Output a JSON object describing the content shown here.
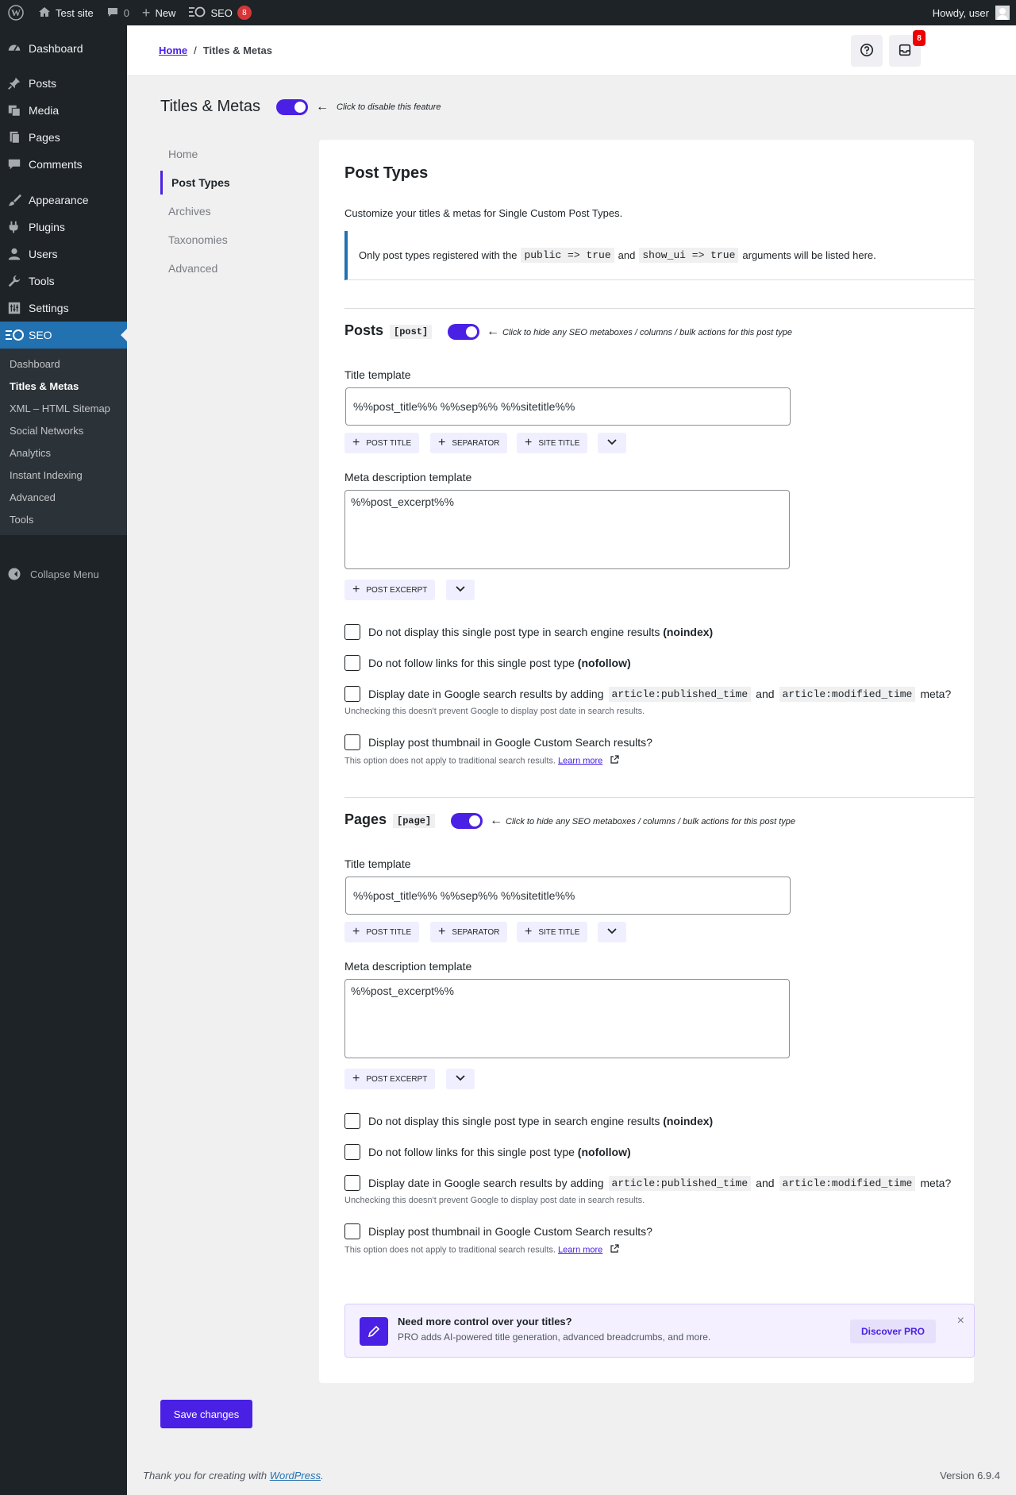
{
  "adminbar": {
    "site_name": "Test site",
    "comments_count": "0",
    "new_label": "New",
    "seo_label": "SEO",
    "seo_badge": "8",
    "greeting": "Howdy, user"
  },
  "menu": {
    "items": [
      {
        "label": "Dashboard",
        "icon": "dashboard-icon"
      },
      {
        "label": "Posts",
        "icon": "pin-icon"
      },
      {
        "label": "Media",
        "icon": "media-icon"
      },
      {
        "label": "Pages",
        "icon": "pages-icon"
      },
      {
        "label": "Comments",
        "icon": "comment-icon"
      },
      {
        "label": "Appearance",
        "icon": "brush-icon"
      },
      {
        "label": "Plugins",
        "icon": "plug-icon"
      },
      {
        "label": "Users",
        "icon": "user-icon"
      },
      {
        "label": "Tools",
        "icon": "wrench-icon"
      },
      {
        "label": "Settings",
        "icon": "settings-icon"
      },
      {
        "label": "SEO",
        "icon": "seo-icon"
      }
    ],
    "submenu": [
      "Dashboard",
      "Titles & Metas",
      "XML – HTML Sitemap",
      "Social Networks",
      "Analytics",
      "Instant Indexing",
      "Advanced",
      "Tools"
    ],
    "collapse": "Collapse Menu"
  },
  "topbar": {
    "home": "Home",
    "separator": "/",
    "current": "Titles & Metas",
    "notif_count": "8"
  },
  "header": {
    "title": "Titles & Metas",
    "toggle_hint": "Click to disable this feature"
  },
  "subnav": [
    "Home",
    "Post Types",
    "Archives",
    "Taxonomies",
    "Advanced"
  ],
  "card": {
    "title": "Post Types",
    "intro": "Customize your titles & metas for Single Custom Post Types.",
    "notice": {
      "pre": "Only post types registered with the",
      "code1": "public => true",
      "mid": "and",
      "code2": "show_ui => true",
      "post": "arguments will be listed here."
    }
  },
  "sections": [
    {
      "name": "Posts",
      "slug": "[post]",
      "toggle_hint": "Click to hide any SEO metaboxes / columns / bulk actions for this post type",
      "title_label": "Title template",
      "title_value": "%%post_title%% %%sep%% %%sitetitle%%",
      "title_tags": [
        "POST TITLE",
        "SEPARATOR",
        "SITE TITLE"
      ],
      "meta_label": "Meta description template",
      "meta_value": "%%post_excerpt%%",
      "meta_tags": [
        "POST EXCERPT"
      ],
      "noindex_pre": "Do not display this single post type in search engine results",
      "noindex_bold": "(noindex)",
      "nofollow_pre": "Do not follow links for this single post type",
      "nofollow_bold": "(nofollow)",
      "date_pre": "Display date in Google search results by adding",
      "date_code1": "article:published_time",
      "date_mid": "and",
      "date_code2": "article:modified_time",
      "date_post": "meta?",
      "date_desc": "Unchecking this doesn't prevent Google to display post date in search results.",
      "thumb_label": "Display post thumbnail in Google Custom Search results?",
      "thumb_desc": "This option does not apply to traditional search results.",
      "learn_more": "Learn more"
    },
    {
      "name": "Pages",
      "slug": "[page]",
      "toggle_hint": "Click to hide any SEO metaboxes / columns / bulk actions for this post type",
      "title_label": "Title template",
      "title_value": "%%post_title%% %%sep%% %%sitetitle%%",
      "title_tags": [
        "POST TITLE",
        "SEPARATOR",
        "SITE TITLE"
      ],
      "meta_label": "Meta description template",
      "meta_value": "%%post_excerpt%%",
      "meta_tags": [
        "POST EXCERPT"
      ],
      "noindex_pre": "Do not display this single post type in search engine results",
      "noindex_bold": "(noindex)",
      "nofollow_pre": "Do not follow links for this single post type",
      "nofollow_bold": "(nofollow)",
      "date_pre": "Display date in Google search results by adding",
      "date_code1": "article:published_time",
      "date_mid": "and",
      "date_code2": "article:modified_time",
      "date_post": "meta?",
      "date_desc": "Unchecking this doesn't prevent Google to display post date in search results.",
      "thumb_label": "Display post thumbnail in Google Custom Search results?",
      "thumb_desc": "This option does not apply to traditional search results.",
      "learn_more": "Learn more"
    }
  ],
  "pro": {
    "title": "Need more control over your titles?",
    "text": "PRO adds AI-powered title generation, advanced breadcrumbs, and more.",
    "button": "Discover PRO",
    "close": "×"
  },
  "save_label": "Save changes",
  "footer": {
    "thanks_pre": "Thank you for creating with",
    "thanks_link": "WordPress",
    "thanks_post": ".",
    "version": "Version 6.9.4"
  },
  "colors": {
    "accent": "#4a20e5",
    "wp_blue": "#2271b1",
    "admin_dark": "#1d2327"
  }
}
